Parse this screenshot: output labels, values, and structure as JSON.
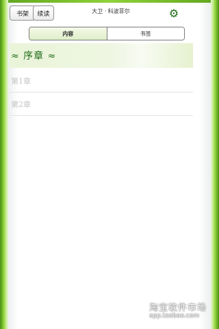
{
  "header": {
    "shelf_button": "书架",
    "continue_button": "续读",
    "book_title": "大卫 · 科波菲尔",
    "settings_icon": "gear-icon"
  },
  "tabs": [
    {
      "label": "内容",
      "selected": true
    },
    {
      "label": "书签",
      "selected": false
    }
  ],
  "chapters": [
    {
      "label": "≈ 序章 ≈",
      "highlighted": true
    },
    {
      "label": "第1章",
      "highlighted": false
    },
    {
      "label": "第2章",
      "highlighted": false
    }
  ],
  "watermark": {
    "title": "淘宝软件市场",
    "url": "app.taobao.com"
  },
  "colors": {
    "frame_green": "#5fa51e",
    "accent_text": "#1f6b1a",
    "tab_selected": "#dfeec8",
    "chapter_muted": "#c5c5c5"
  }
}
